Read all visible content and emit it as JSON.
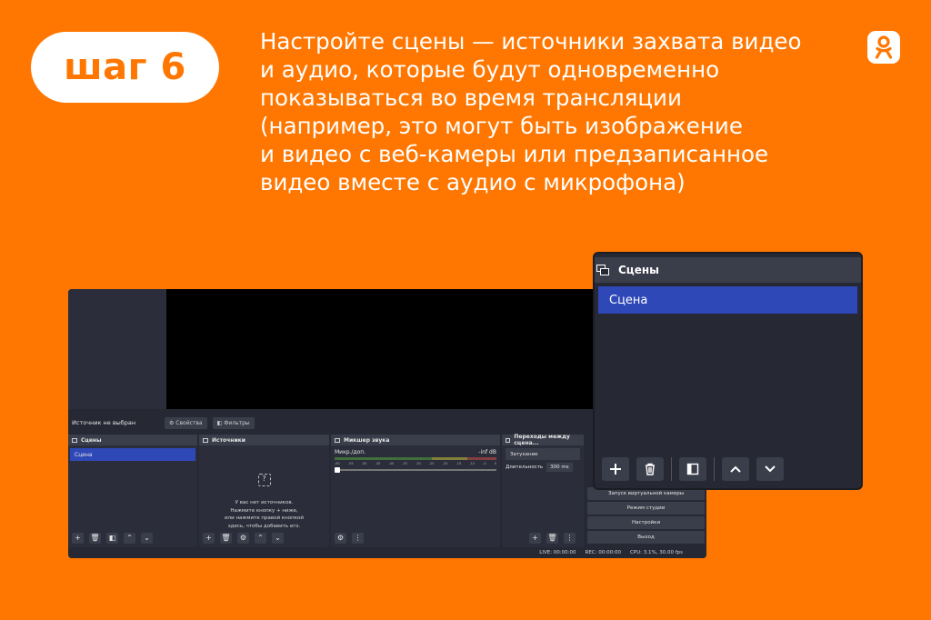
{
  "step_label": "шаг 6",
  "headline": "Настройте сцены — источники захвата видео\nи аудио, которые будут одновременно\nпоказываться во время трансляции\n(например, это могут быть изображение\nи видео с веб-камеры или предзаписанное\nвидео вместе с аудио с микрофона)",
  "colors": {
    "background": "#ff7700",
    "accent_blue": "#2e48b8",
    "panel": "#2b2e3a"
  },
  "obs": {
    "source_bar": {
      "no_source": "Источник не выбран",
      "properties": "Свойства",
      "filters": "Фильтры"
    },
    "scenes_dock": {
      "title": "Сцены",
      "items": [
        "Сцена"
      ]
    },
    "sources_dock": {
      "title": "Источники",
      "empty_text": "У вас нет источников.\nНажмите кнопку + ниже,\nили нажмите правой кнопкой\nздесь, чтобы добавить его."
    },
    "mixer_dock": {
      "title": "Микшер звука",
      "channel": "Микр./доп.",
      "level": "-inf dB",
      "ticks": [
        "-60",
        "-55",
        "-50",
        "-45",
        "-40",
        "-35",
        "-30",
        "-25",
        "-20",
        "-15",
        "-10",
        "-5",
        "0"
      ]
    },
    "transitions_dock": {
      "title": "Переходы между сцена...",
      "transition": "Затухание",
      "duration_label": "Длительность",
      "duration_value": "300 ms"
    },
    "controls": {
      "virtual_camera": "Запуск виртуальной камеры",
      "studio_mode": "Режим студии",
      "settings": "Настройки",
      "exit": "Выход"
    },
    "status": {
      "live": "LIVE: 00:00:00",
      "rec": "REC: 00:00:00",
      "cpu": "CPU: 3.1%, 30.00 fps"
    }
  },
  "zoom_panel": {
    "title": "Сцены",
    "items": [
      "Сцена"
    ]
  },
  "icons": [
    "ok-logo-icon",
    "scenes-icon",
    "plus-icon",
    "trash-icon",
    "filter-icon",
    "chevron-up-icon",
    "chevron-down-icon",
    "gear-icon",
    "menu-dots-icon",
    "question-icon"
  ]
}
